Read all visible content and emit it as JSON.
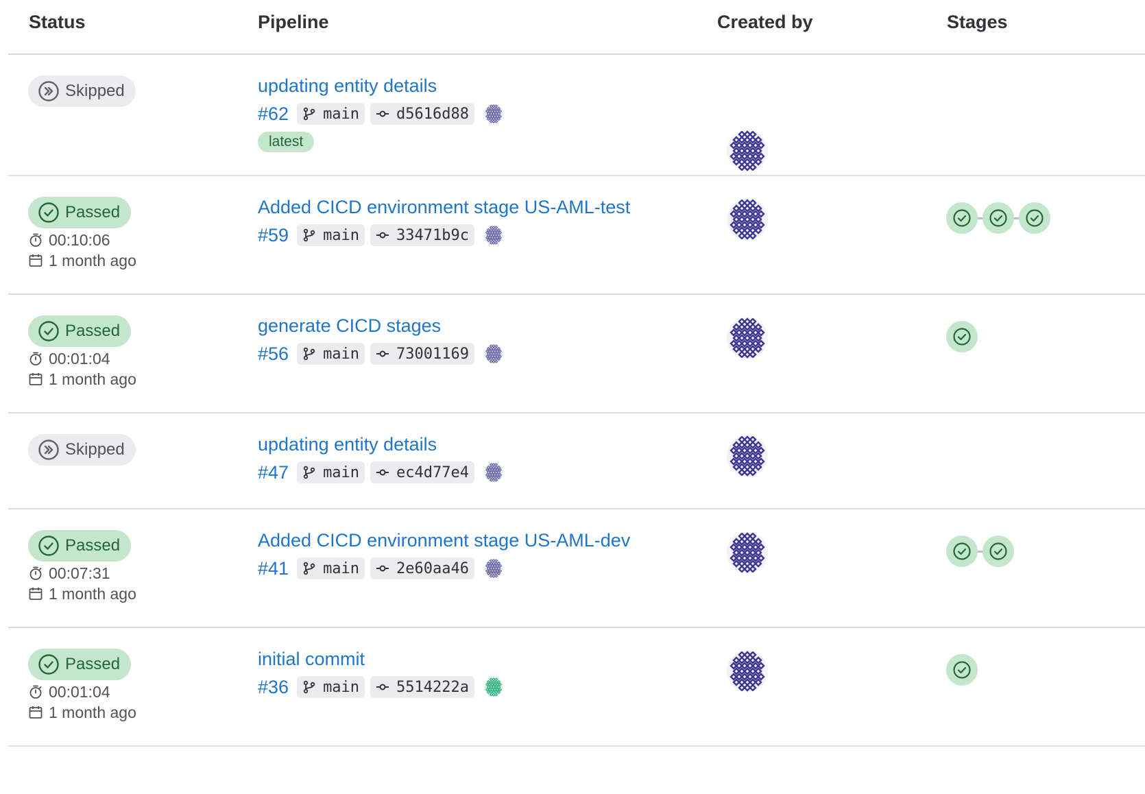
{
  "columns": {
    "status": "Status",
    "pipeline": "Pipeline",
    "created_by": "Created by",
    "stages": "Stages"
  },
  "colors": {
    "link": "#1f75cb",
    "passed_bg": "#c3e6cd",
    "passed_text": "#24663b",
    "skipped_bg": "#ececef",
    "avatar_pattern": "#3e3690"
  },
  "rows": [
    {
      "status": "Skipped",
      "title": "updating entity details",
      "id": "#62",
      "branch": "main",
      "commit": "d5616d88",
      "tag": "latest",
      "stages": 0
    },
    {
      "status": "Passed",
      "duration": "00:10:06",
      "finished": "1 month ago",
      "title": "Added CICD environment stage US-AML-test",
      "id": "#59",
      "branch": "main",
      "commit": "33471b9c",
      "stages": 3
    },
    {
      "status": "Passed",
      "duration": "00:01:04",
      "finished": "1 month ago",
      "title": "generate CICD stages",
      "id": "#56",
      "branch": "main",
      "commit": "73001169",
      "stages": 1
    },
    {
      "status": "Skipped",
      "title": "updating entity details",
      "id": "#47",
      "branch": "main",
      "commit": "ec4d77e4",
      "stages": 0
    },
    {
      "status": "Passed",
      "duration": "00:07:31",
      "finished": "1 month ago",
      "title": "Added CICD environment stage US-AML-dev",
      "id": "#41",
      "branch": "main",
      "commit": "2e60aa46",
      "stages": 2
    },
    {
      "status": "Passed",
      "duration": "00:01:04",
      "finished": "1 month ago",
      "title": "initial commit",
      "id": "#36",
      "branch": "main",
      "commit": "5514222a",
      "stages": 1
    }
  ]
}
